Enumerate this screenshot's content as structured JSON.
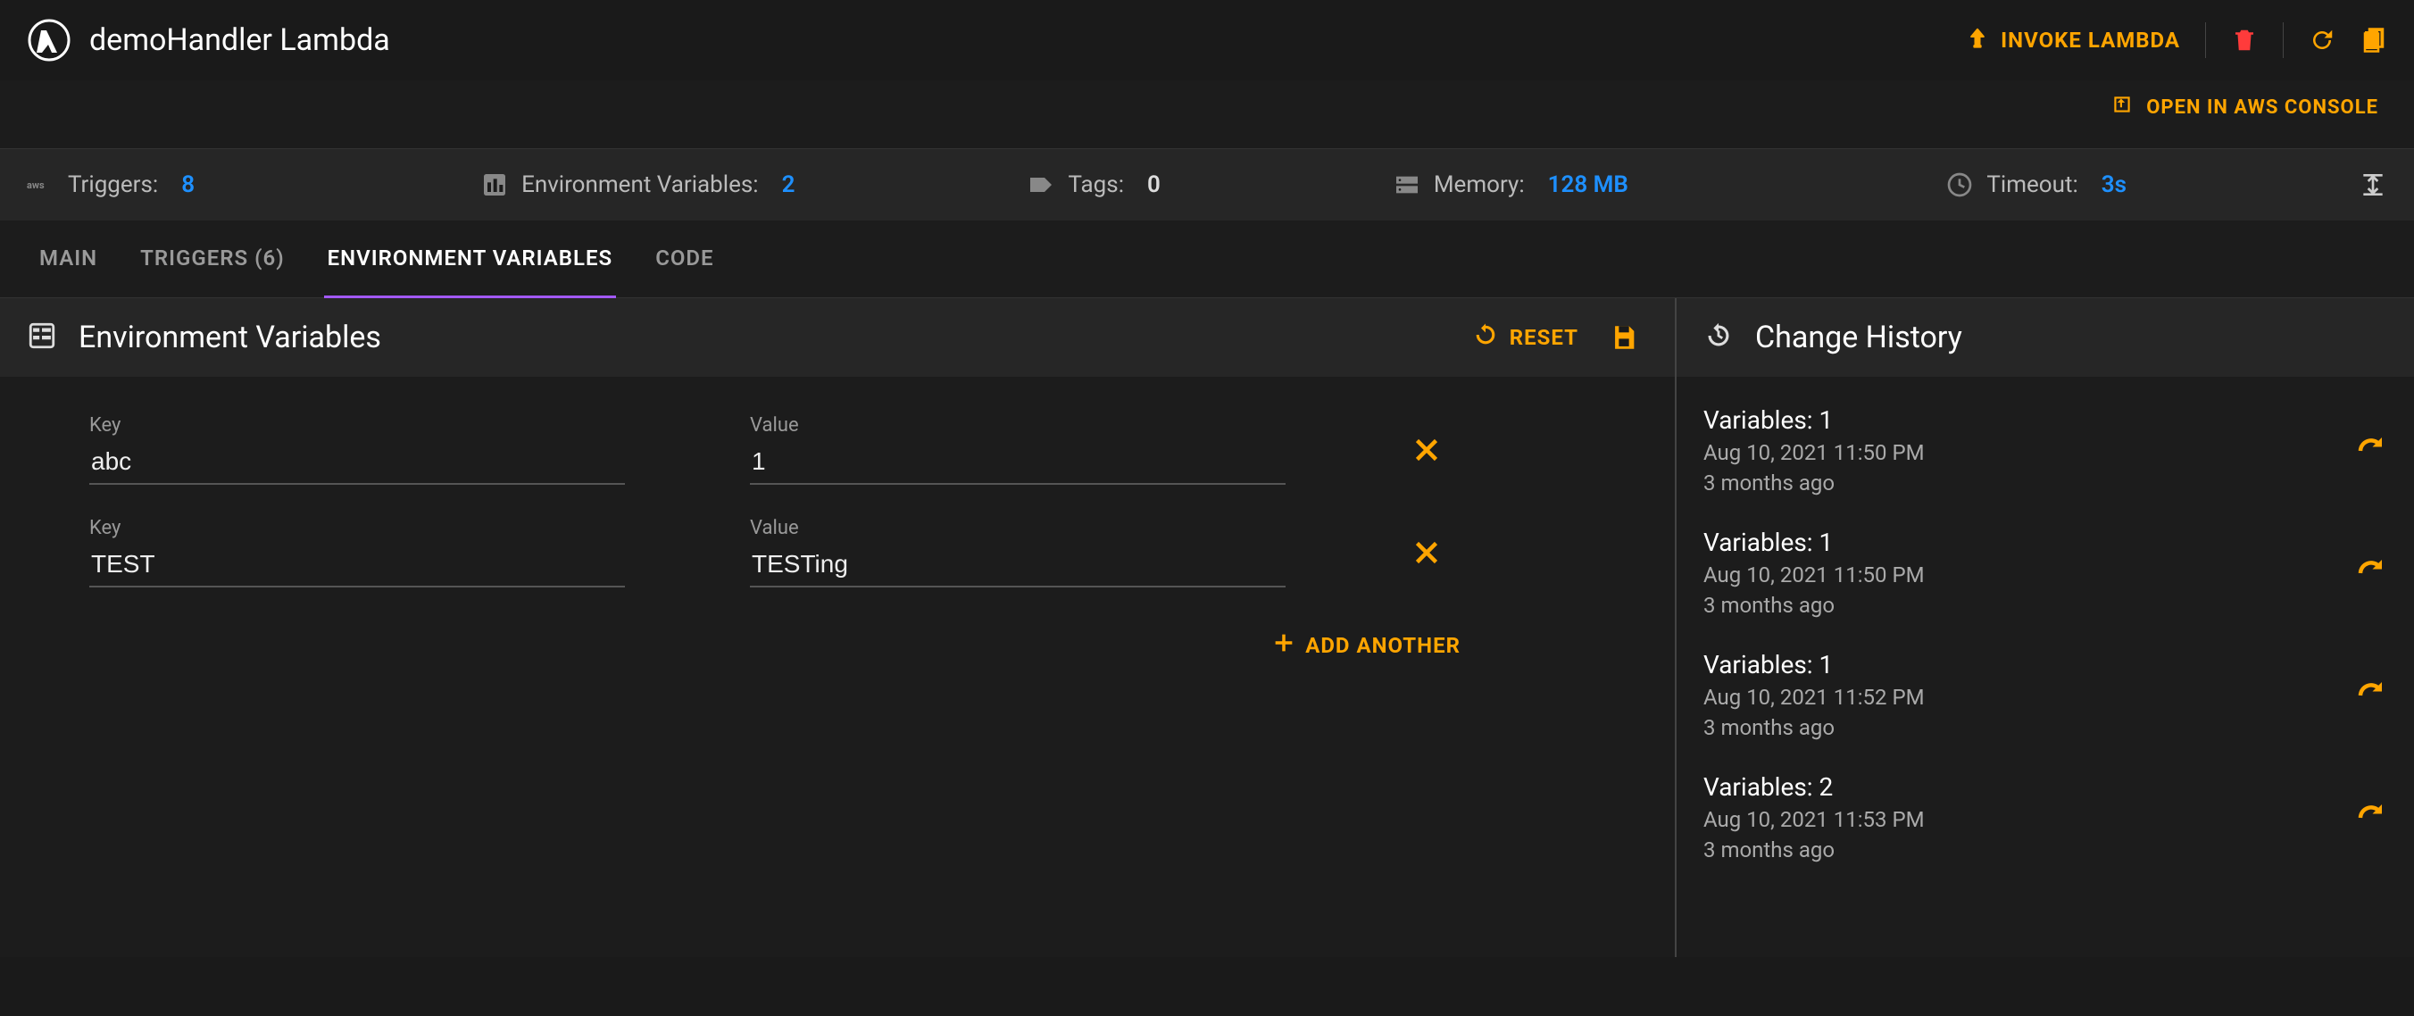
{
  "header": {
    "title": "demoHandler Lambda",
    "invoke_label": "INVOKE LAMBDA",
    "open_console_label": "OPEN IN AWS CONSOLE"
  },
  "colors": {
    "accent": "#ffa500",
    "link": "#1e90ff",
    "tab_active": "#a259ff",
    "danger": "#ff3b3b"
  },
  "stats": {
    "triggers_label": "Triggers:",
    "triggers_value": "8",
    "envvars_label": "Environment Variables:",
    "envvars_value": "2",
    "tags_label": "Tags:",
    "tags_value": "0",
    "memory_label": "Memory:",
    "memory_value": "128 MB",
    "timeout_label": "Timeout:",
    "timeout_value": "3s"
  },
  "tabs": {
    "main": "MAIN",
    "triggers": "TRIGGERS (6)",
    "envvars": "ENVIRONMENT VARIABLES",
    "code": "CODE",
    "active": "envvars"
  },
  "env_panel": {
    "title": "Environment Variables",
    "reset_label": "RESET",
    "key_label": "Key",
    "value_label": "Value",
    "add_label": "ADD ANOTHER",
    "rows": [
      {
        "key": "abc",
        "value": "1"
      },
      {
        "key": "TEST",
        "value": "TESTing"
      }
    ]
  },
  "history_panel": {
    "title": "Change History",
    "items": [
      {
        "title": "Variables: 1",
        "date": "Aug 10, 2021 11:50 PM",
        "ago": "3 months ago"
      },
      {
        "title": "Variables: 1",
        "date": "Aug 10, 2021 11:50 PM",
        "ago": "3 months ago"
      },
      {
        "title": "Variables: 1",
        "date": "Aug 10, 2021 11:52 PM",
        "ago": "3 months ago"
      },
      {
        "title": "Variables: 2",
        "date": "Aug 10, 2021 11:53 PM",
        "ago": "3 months ago"
      }
    ]
  }
}
